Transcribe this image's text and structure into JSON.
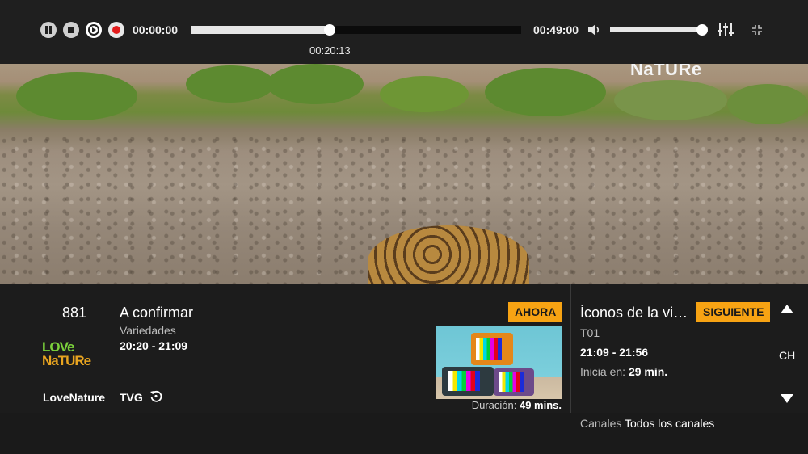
{
  "player": {
    "time_start": "00:00:00",
    "time_end": "00:49:00",
    "time_tooltip": "00:20:13",
    "progress_fraction": 0.42,
    "volume_fraction": 0.98,
    "controls": [
      "pause-icon",
      "stop-icon",
      "restart-icon",
      "record-icon"
    ],
    "accent_color": "#e21b1b"
  },
  "video": {
    "watermark": "NaTURe"
  },
  "channel": {
    "number": "881",
    "logo_line1": "LOVe",
    "logo_line2": "NaTURe",
    "name": "LoveNature"
  },
  "current": {
    "title": "A confirmar",
    "genre": "Variedades",
    "time": "20:20 - 21:09",
    "rating": "TVG",
    "badge": "AHORA",
    "duration_label": "Duración:",
    "duration_value": "49 mins."
  },
  "next": {
    "title": "Íconos de la vida salvaje",
    "badge": "SIGUIENTE",
    "episode": "T01",
    "time": "21:09 - 21:56",
    "starts_label": "Inicia en:",
    "starts_value": "29 min."
  },
  "nav": {
    "ch_label": "CH"
  },
  "footer": {
    "label": "Canales",
    "value": "Todos los canales"
  },
  "colors": {
    "badge": "#f7a313",
    "background": "#1c1c1c"
  }
}
